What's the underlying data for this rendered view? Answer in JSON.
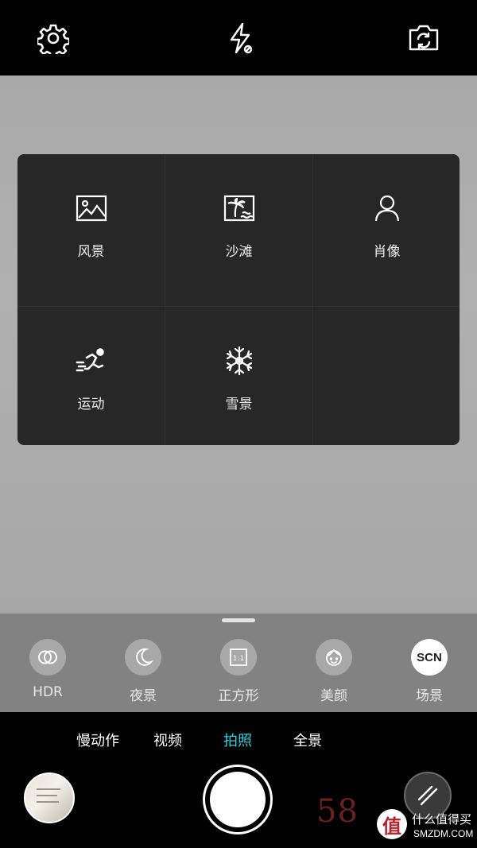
{
  "topbar": {
    "settings_icon": "gear-icon",
    "flash_icon": "flash-off-icon",
    "switch_icon": "camera-switch-icon"
  },
  "scene_panel": {
    "items": [
      {
        "label": "风景",
        "icon": "landscape-icon"
      },
      {
        "label": "沙滩",
        "icon": "beach-icon"
      },
      {
        "label": "肖像",
        "icon": "portrait-icon"
      },
      {
        "label": "运动",
        "icon": "sport-icon"
      },
      {
        "label": "雪景",
        "icon": "snowflake-icon"
      }
    ]
  },
  "modes": {
    "items": [
      {
        "label": "HDR",
        "icon": "hdr-icon"
      },
      {
        "label": "夜景",
        "icon": "moon-icon"
      },
      {
        "label": "正方形",
        "icon": "square-1-1-icon",
        "icon_text": "1:1"
      },
      {
        "label": "美颜",
        "icon": "beauty-face-icon"
      },
      {
        "label": "场景",
        "icon": "scn-icon",
        "icon_text": "SCN",
        "active": true
      }
    ]
  },
  "capture_tabs": {
    "items": [
      "慢动作",
      "视频",
      "拍照",
      "全景"
    ],
    "active": "拍照",
    "active_color": "#28d6e8"
  },
  "watermark": {
    "number": "58",
    "badge": "值",
    "site_cn": "什么值得买",
    "site_en": "SMZDM.COM"
  }
}
